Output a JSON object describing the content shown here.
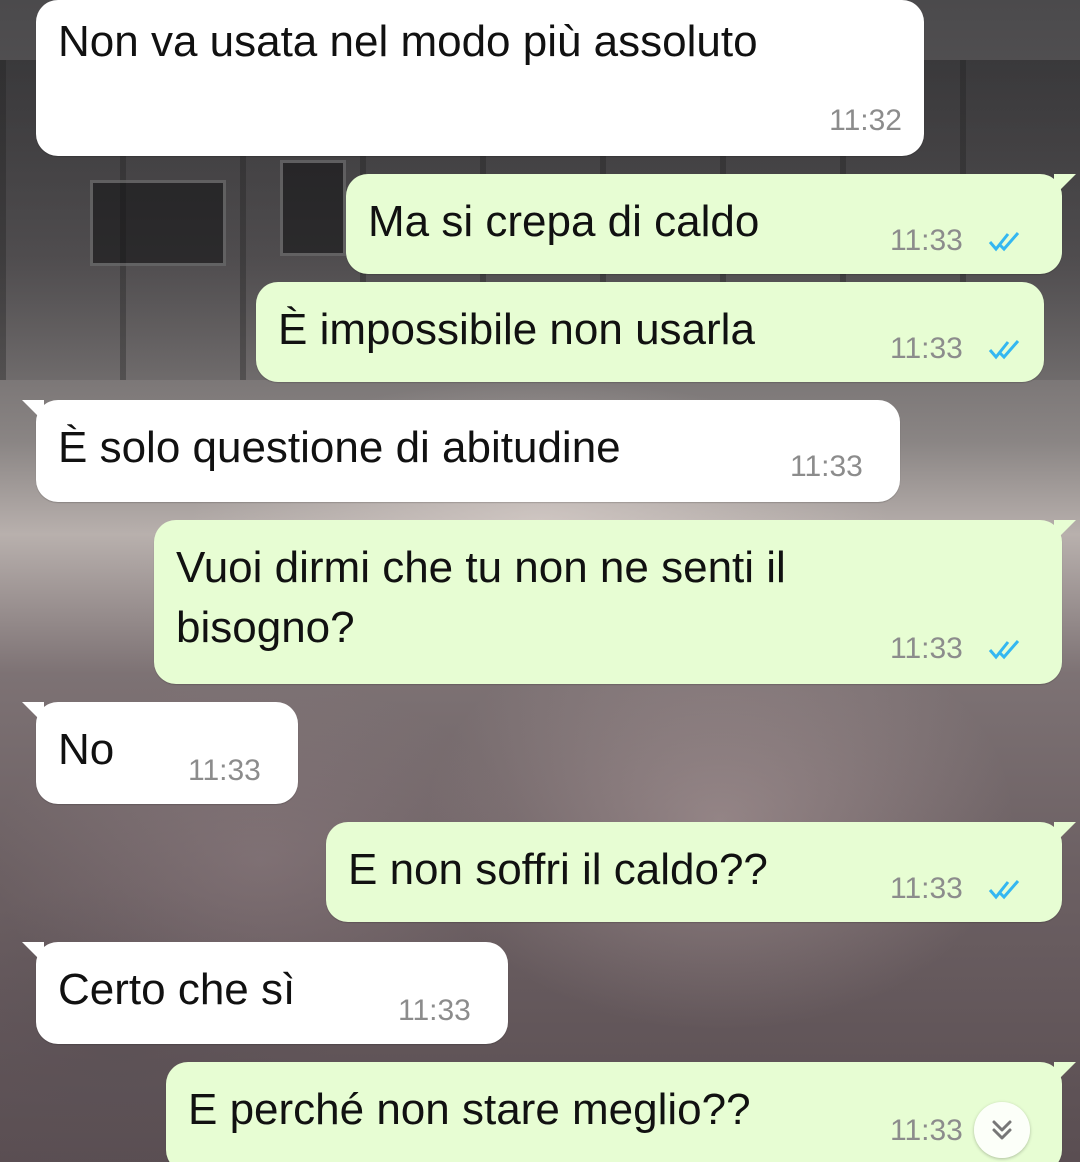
{
  "colors": {
    "incoming_bubble": "#ffffff",
    "outgoing_bubble": "#e7fdd3",
    "read_ticks": "#34b7f1",
    "timestamp": "#8c8c8c"
  },
  "messages": [
    {
      "direction": "in",
      "text": "Non va usata nel modo più assoluto",
      "time": "11:32"
    },
    {
      "direction": "out",
      "text": "Ma si crepa di caldo",
      "time": "11:33",
      "status": "read"
    },
    {
      "direction": "out",
      "text": "È impossibile non usarla",
      "time": "11:33",
      "status": "read"
    },
    {
      "direction": "in",
      "text": "È solo questione di abitudine",
      "time": "11:33"
    },
    {
      "direction": "out",
      "text_line1": "Vuoi dirmi che tu non ne senti il",
      "text_line2": "bisogno?",
      "time": "11:33",
      "status": "read"
    },
    {
      "direction": "in",
      "text": "No",
      "time": "11:33"
    },
    {
      "direction": "out",
      "text": "E non soffri il caldo??",
      "time": "11:33",
      "status": "read"
    },
    {
      "direction": "in",
      "text": "Certo che sì",
      "time": "11:33"
    },
    {
      "direction": "out",
      "text": "E perché non stare meglio??",
      "time": "11:33",
      "status": "read"
    }
  ],
  "scroll_down_icon": "double-chevron-down-icon"
}
